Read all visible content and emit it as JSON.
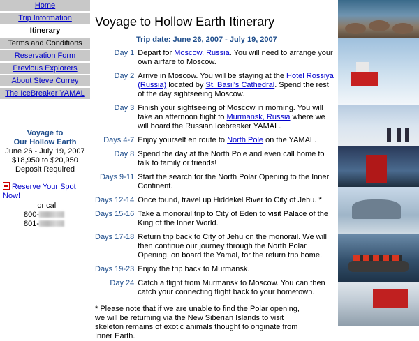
{
  "nav": {
    "items": [
      {
        "label": "Home",
        "state": "link"
      },
      {
        "label": "Trip Information",
        "state": "link"
      },
      {
        "label": "Itinerary",
        "state": "active"
      },
      {
        "label": "Terms and Conditions",
        "state": "plain"
      },
      {
        "label": "Reservation Form",
        "state": "link"
      },
      {
        "label": "Previous Explorers",
        "state": "link"
      },
      {
        "label": "About Steve Currey",
        "state": "link"
      },
      {
        "label": "The IceBreaker YAMAL",
        "state": "link"
      }
    ]
  },
  "promo": {
    "title_line1": "Voyage to",
    "title_line2": "Our Hollow Earth",
    "dates": "June 26 - July 19, 2007",
    "price": "$18,950 to $20,950",
    "deposit": "Deposit Required"
  },
  "reserve": {
    "link": "Reserve Your Spot Now!",
    "or_call": "or call",
    "phone1_prefix": "800-",
    "phone2_prefix": "801-"
  },
  "main": {
    "title": "Voyage to Hollow Earth Itinerary",
    "trip_date": "Trip date: June 26, 2007 - July 19, 2007",
    "days": [
      {
        "day": "Day 1",
        "parts": [
          "Depart for ",
          "Moscow, Russia",
          ". You will need to arrange your own airfare to Moscow."
        ]
      },
      {
        "day": "Day 2",
        "parts": [
          "Arrive in Moscow. You will be staying at the ",
          "Hotel Rossiya (Russia)",
          " located by ",
          "St. Basil's Cathedral",
          ". Spend the rest of the day sightseeing Moscow."
        ]
      },
      {
        "day": "Day 3",
        "parts": [
          "Finish your sightseeing of Moscow in morning. You will take an afternoon flight to ",
          "Murmansk, Russia",
          " where we will board the Russian Icebreaker YAMAL."
        ]
      },
      {
        "day": "Days 4-7",
        "parts": [
          "Enjoy yourself en route to ",
          "North Pole",
          " on the YAMAL."
        ]
      },
      {
        "day": "Day 8",
        "text": "Spend the day at the North Pole and even call home to talk to family or friends!"
      },
      {
        "day": "Days 9-11",
        "text": "Start the search for the North Polar Opening to the Inner Continent."
      },
      {
        "day": "Days 12-14",
        "text": "Once found, travel up Hiddekel River to City of Jehu. *"
      },
      {
        "day": "Days 15-16",
        "text": "Take a monorail trip to City of Eden to visit Palace of the King of the Inner World."
      },
      {
        "day": "Days 17-18",
        "text": "Return trip back to City of Jehu on the monorail. We will then continue our journey through the North Polar Opening, on board the Yamal, for the return trip home."
      },
      {
        "day": "Days 19-23",
        "text": "Enjoy the trip back to Murmansk."
      },
      {
        "day": "Day 24",
        "text": "Catch a flight from Murmansk to Moscow. You can then catch your connecting flight back to your hometown."
      }
    ],
    "footnote": "* Please note that if we are unable to find the Polar opening, we will be returning via the New Siberian Islands to visit skeleton remains of exotic animals thought to originate from Inner Earth."
  },
  "colors": {
    "accent": "#1f4e8c",
    "link": "#0000cc",
    "nav_bg": "#c8c8c8"
  }
}
